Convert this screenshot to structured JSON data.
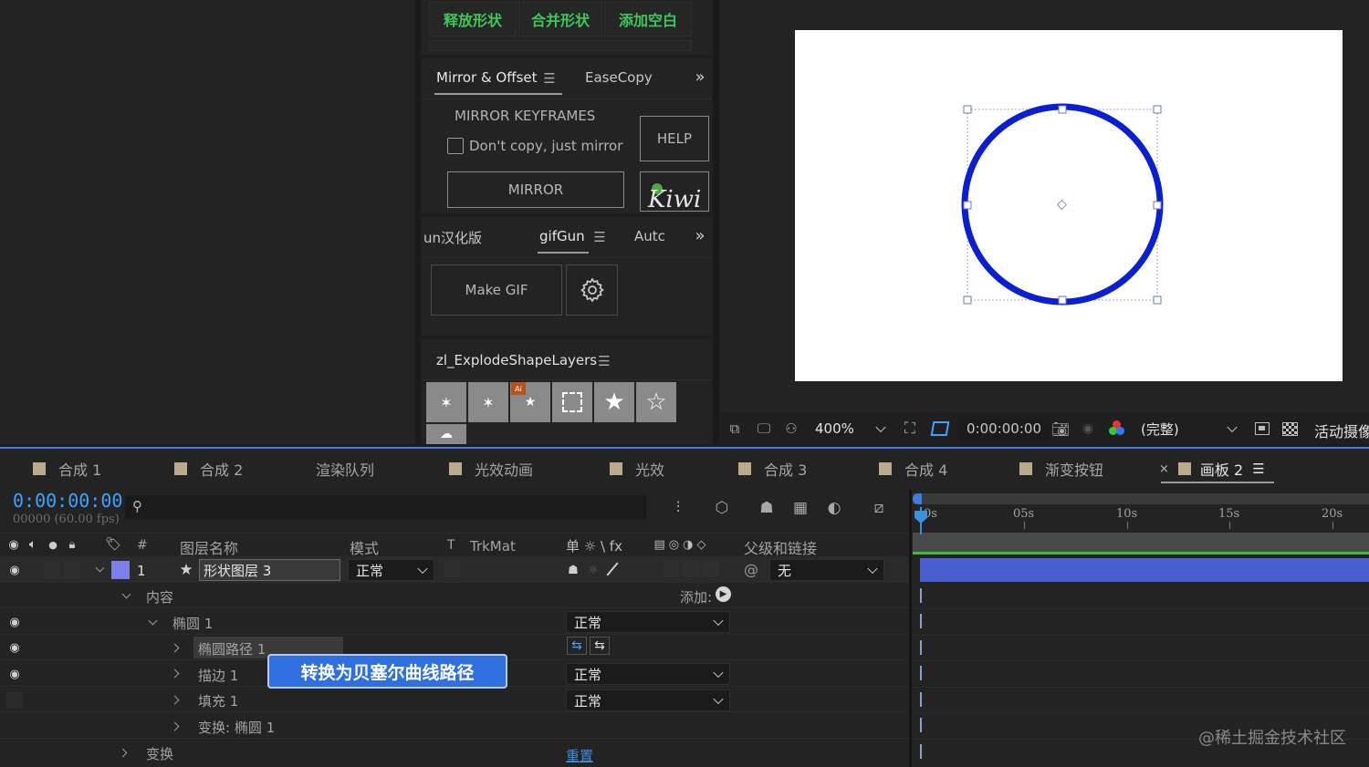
{
  "top_buttons": [
    "释放形状",
    "合并形状",
    "添加空白"
  ],
  "mirror_panel": {
    "tab_active": "Mirror & Offset",
    "tab_other": "EaseCopy",
    "section_title": "MIRROR KEYFRAMES",
    "checkbox_label": "Don't copy, just mirror",
    "mirror_button": "MIRROR",
    "help_button": "HELP",
    "logo_text": "Kiwi"
  },
  "gifgun_panel": {
    "tab_left": "un汉化版",
    "tab_active": "gifGun",
    "tab_right": "Autc",
    "make_gif": "Make GIF"
  },
  "explode_panel": {
    "title": "zl_ExplodeShapeLayers"
  },
  "viewer_toolbar": {
    "zoom": "400%",
    "timecode": "0:00:00:00",
    "resolution": "(完整)",
    "camera": "活动摄像"
  },
  "comp_tabs": [
    "合成 1",
    "合成 2",
    "渲染队列",
    "光效动画",
    "光效",
    "合成 3",
    "合成 4",
    "渐变按钮",
    "画板 2"
  ],
  "timeline": {
    "timecode": "0:00:00:00",
    "fps": "00000 (60.00 fps)",
    "headers": {
      "hash": "#",
      "layer_name": "图层名称",
      "mode": "模式",
      "t": "T",
      "trkmat": "TrkMat",
      "switches": "单 ☼ \\ fx",
      "parent": "父级和链接"
    },
    "layer": {
      "number": "1",
      "name": "形状图层 3",
      "mode": "正常",
      "parent": "无"
    },
    "rows": {
      "contents": "内容",
      "add_label": "添加:",
      "ellipse": "椭圆 1",
      "ellipse_mode": "正常",
      "ellipse_path": "椭圆路径 1",
      "stroke": "描边 1",
      "stroke_mode": "正常",
      "fill": "填充 1",
      "fill_mode": "正常",
      "transform_ellipse": "变换: 椭圆 1",
      "transform": "变换",
      "reset": "重置"
    },
    "context_menu": "转换为贝塞尔曲线路径",
    "ruler": [
      "0s",
      "05s",
      "10s",
      "15s",
      "20s"
    ]
  },
  "watermark": "@稀土掘金技术社区",
  "colors": {
    "green": "#3ec85a",
    "timecode_blue": "#3fa2ff",
    "circle_blue": "#0a1fd0",
    "label_purple": "#7b80e8",
    "menu_blue": "#2f6fe0",
    "track_bar": "#4a5fcf"
  }
}
